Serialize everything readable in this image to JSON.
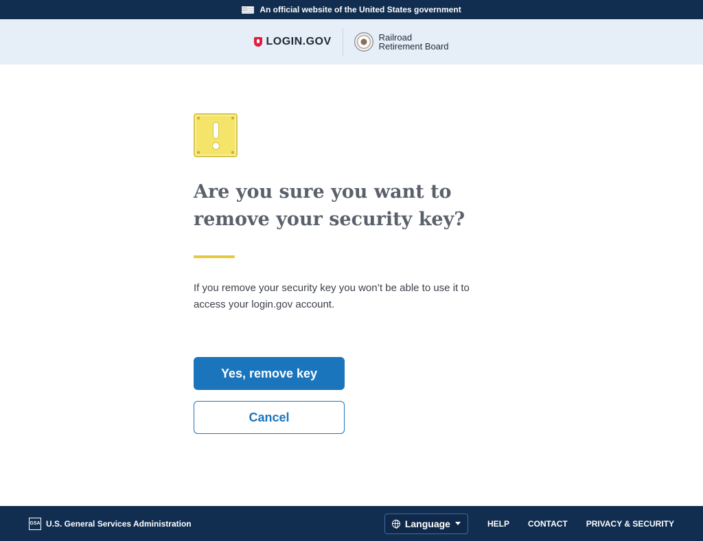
{
  "banner": {
    "text": "An official website of the United States government"
  },
  "header": {
    "logo_text": "LOGIN.GOV",
    "agency_line1": "Railroad",
    "agency_line2": "Retirement Board"
  },
  "main": {
    "heading": "Are you sure you want to remove your security key?",
    "body": "If you remove your security key you won’t be able to use it to access your login.gov account.",
    "primary_button": "Yes, remove key",
    "secondary_button": "Cancel"
  },
  "footer": {
    "agency": "U.S. General Services Administration",
    "gsa_logo_text": "GSA",
    "language_label": "Language",
    "links": [
      "HELP",
      "CONTACT",
      "PRIVACY & SECURITY"
    ]
  },
  "colors": {
    "navy": "#112e51",
    "primary_blue": "#1a75bc",
    "accent_yellow": "#e7c93f",
    "header_bg": "#e6eef7"
  }
}
